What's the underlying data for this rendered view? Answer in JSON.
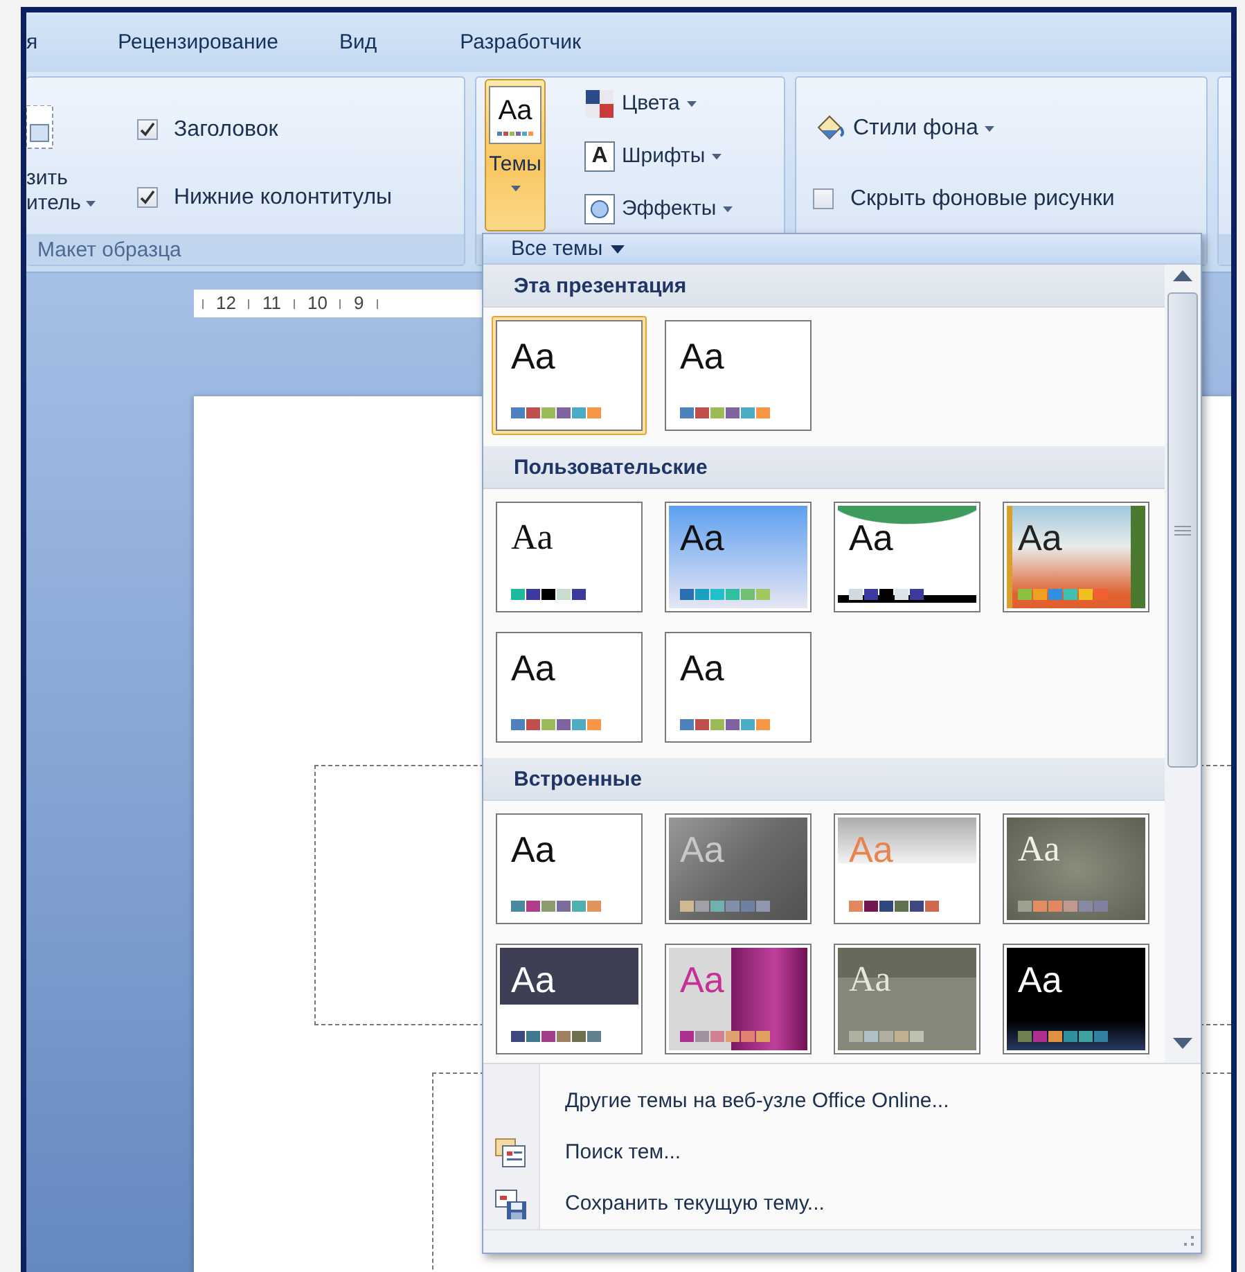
{
  "ribbon_tabs": [
    {
      "label": "я",
      "selected": false
    },
    {
      "label": "Рецензирование",
      "selected": false
    },
    {
      "label": "Вид",
      "selected": false
    },
    {
      "label": "Разработчик",
      "selected": false
    }
  ],
  "slide_master_group": {
    "button_label_lines": [
      "зить",
      "итель"
    ],
    "checkboxes": [
      {
        "label": "Заголовок",
        "checked": true
      },
      {
        "label": "Нижние колонтитулы",
        "checked": true
      }
    ],
    "group_label": "Макет образца"
  },
  "themes_group": {
    "themes_button": {
      "label": "Темы",
      "sample": "Aa",
      "pressed": true
    },
    "commands": [
      {
        "label": "Цвета",
        "kind": "colors"
      },
      {
        "label": "Шрифты",
        "kind": "fonts",
        "glyph": "A"
      },
      {
        "label": "Эффекты",
        "kind": "effects"
      }
    ]
  },
  "background_group": {
    "styles_button": {
      "label": "Стили фона"
    },
    "checkboxes": [
      {
        "label": "Скрыть фоновые рисунки",
        "checked": false
      }
    ]
  },
  "ruler": [
    "12",
    "11",
    "10",
    "9"
  ],
  "themes_menu": {
    "header": "Все темы",
    "sections": [
      {
        "title": "Эта презентация",
        "themes": [
          {
            "label": "Aa",
            "kind": "plain",
            "selected": true,
            "swatches": [
              {
                "color": "#4f81bd"
              },
              {
                "color": "#c0504d"
              },
              {
                "color": "#9bbb59"
              },
              {
                "color": "#8064a2"
              },
              {
                "color": "#4bacc6"
              },
              {
                "color": "#f79646"
              }
            ]
          },
          {
            "label": "Aa",
            "kind": "plain",
            "selected": false,
            "swatches": [
              {
                "color": "#4f81bd"
              },
              {
                "color": "#c0504d"
              },
              {
                "color": "#9bbb59"
              },
              {
                "color": "#8064a2"
              },
              {
                "color": "#4bacc6"
              },
              {
                "color": "#f79646"
              }
            ]
          }
        ]
      },
      {
        "title": "Пользовательские",
        "themes": [
          {
            "label": "Aa",
            "kind": "serif",
            "selected": false,
            "swatches": [
              {
                "color": "#20b89a"
              },
              {
                "color": "#3c3aa0"
              },
              {
                "color": "#000000"
              },
              {
                "color": "#c8dcd0"
              },
              {
                "color": "#3c3aa0"
              }
            ]
          },
          {
            "label": "Aa",
            "kind": "sky",
            "selected": false,
            "swatches": [
              {
                "color": "#2a6fb4"
              },
              {
                "color": "#1aa0c0"
              },
              {
                "color": "#22c0c8"
              },
              {
                "color": "#30c0a0"
              },
              {
                "color": "#70c070"
              },
              {
                "color": "#a0c860"
              }
            ]
          },
          {
            "label": "Aa",
            "kind": "banner",
            "selected": false,
            "swatches": [
              {
                "color": "#d0d8e0"
              },
              {
                "color": "#3c3aa0"
              },
              {
                "color": "#000000"
              },
              {
                "color": "#dce4ea"
              },
              {
                "color": "#3c3aa0"
              }
            ]
          },
          {
            "label": "Aa",
            "kind": "floral",
            "selected": false,
            "swatches": [
              {
                "color": "#8cc040"
              },
              {
                "color": "#f0a020"
              },
              {
                "color": "#3090e0"
              },
              {
                "color": "#40c0b0"
              },
              {
                "color": "#f0c020"
              },
              {
                "color": "#f06030"
              }
            ]
          },
          {
            "label": "Aa",
            "kind": "plain",
            "selected": false,
            "swatches": [
              {
                "color": "#4f81bd"
              },
              {
                "color": "#c0504d"
              },
              {
                "color": "#9bbb59"
              },
              {
                "color": "#8064a2"
              },
              {
                "color": "#4bacc6"
              },
              {
                "color": "#f79646"
              }
            ]
          },
          {
            "label": "Aa",
            "kind": "plain",
            "selected": false,
            "swatches": [
              {
                "color": "#4f81bd"
              },
              {
                "color": "#c0504d"
              },
              {
                "color": "#9bbb59"
              },
              {
                "color": "#8064a2"
              },
              {
                "color": "#4bacc6"
              },
              {
                "color": "#f79646"
              }
            ]
          }
        ]
      },
      {
        "title": "Встроенные",
        "themes": [
          {
            "label": "Aa",
            "kind": "plain",
            "selected": false,
            "swatches": [
              {
                "color": "#4a8aa0"
              },
              {
                "color": "#b03c8c"
              },
              {
                "color": "#8c9c70"
              },
              {
                "color": "#7c6c9c"
              },
              {
                "color": "#50b0b0"
              },
              {
                "color": "#e0945c"
              }
            ]
          },
          {
            "label": "Aa",
            "kind": "smoke",
            "selected": false,
            "swatches": [
              {
                "color": "#d0b890"
              },
              {
                "color": "#a0a0a8"
              },
              {
                "color": "#70b0b0"
              },
              {
                "color": "#8090a8"
              },
              {
                "color": "#7080a0"
              },
              {
                "color": "#9098b0"
              }
            ]
          },
          {
            "label": "Aa",
            "kind": "silver",
            "selected": false,
            "swatches": [
              {
                "color": "#e08860"
              },
              {
                "color": "#701850"
              },
              {
                "color": "#304880"
              },
              {
                "color": "#607050"
              },
              {
                "color": "#404880"
              },
              {
                "color": "#d06850"
              }
            ]
          },
          {
            "label": "Aa",
            "kind": "olive",
            "selected": false,
            "swatches": [
              {
                "color": "#a0a090"
              },
              {
                "color": "#e09060"
              },
              {
                "color": "#e08860"
              },
              {
                "color": "#c09890"
              },
              {
                "color": "#8888a0"
              },
              {
                "color": "#8080a0"
              }
            ]
          },
          {
            "label": "Aa",
            "kind": "slate",
            "selected": false,
            "swatches": [
              {
                "color": "#404880"
              },
              {
                "color": "#407890"
              },
              {
                "color": "#a0408c"
              },
              {
                "color": "#a08060"
              },
              {
                "color": "#707050"
              },
              {
                "color": "#608090"
              }
            ]
          },
          {
            "label": "Aa",
            "kind": "magenta",
            "selected": false,
            "swatches": [
              {
                "color": "#b03090"
              },
              {
                "color": "#a090a0"
              },
              {
                "color": "#d08090"
              },
              {
                "color": "#e0a070"
              },
              {
                "color": "#e08070"
              },
              {
                "color": "#e0a060"
              }
            ]
          },
          {
            "label": "Aa",
            "kind": "khaki",
            "selected": false,
            "swatches": [
              {
                "color": "#b0b0a0"
              },
              {
                "color": "#b0c0c8"
              },
              {
                "color": "#b0b0a0"
              },
              {
                "color": "#c0b090"
              },
              {
                "color": "#c0c0b0"
              }
            ]
          },
          {
            "label": "Aa",
            "kind": "black",
            "selected": false,
            "swatches": [
              {
                "color": "#708050"
              },
              {
                "color": "#b03090"
              },
              {
                "color": "#e09040"
              },
              {
                "color": "#3090a0"
              },
              {
                "color": "#40a0a0"
              },
              {
                "color": "#3080a0"
              }
            ]
          }
        ]
      }
    ],
    "footer_items": [
      {
        "label": "Другие темы на веб-узле Office Online...",
        "kind": "none"
      },
      {
        "label": "Поиск тем...",
        "kind": "browse"
      },
      {
        "label": "Сохранить текущую тему...",
        "kind": "save"
      }
    ]
  }
}
